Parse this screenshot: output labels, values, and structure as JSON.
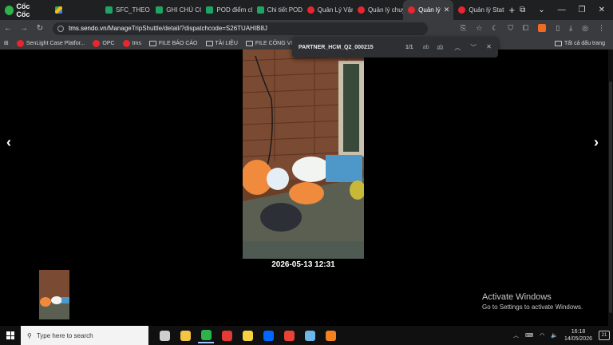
{
  "browser": {
    "brand": "Cốc Cốc",
    "tabs": [
      {
        "title": "",
        "favicon": "drive-icon"
      },
      {
        "title": "SFC_THEO D",
        "favicon": "sheets-icon"
      },
      {
        "title": "GHI CHÚ CÔ",
        "favicon": "sheets-icon"
      },
      {
        "title": "POD điểm cl",
        "favicon": "spreadsheet-icon"
      },
      {
        "title": "Chi tiết POD",
        "favicon": "spreadsheet-icon"
      },
      {
        "title": "Quản Lý Vận",
        "favicon": "sendo-icon"
      },
      {
        "title": "Quản lý chuy",
        "favicon": "sendo-icon"
      },
      {
        "title": "Quản lý",
        "favicon": "sendo-icon",
        "active": true
      },
      {
        "title": "Quản lý Stati",
        "favicon": "sendo-icon"
      }
    ],
    "url_host": "tms.sendo.vn",
    "url_path": "/ManageTripShuttle/detail/?dispatchcode=S26TUAHIB8J",
    "bookmarks": [
      {
        "label": "SenLight Case Platfor...",
        "type": "site"
      },
      {
        "label": "OPC",
        "type": "site"
      },
      {
        "label": "tms",
        "type": "site"
      },
      {
        "label": "FILE BÁO CÁO",
        "type": "folder"
      },
      {
        "label": "TÀI LIỆU",
        "type": "folder"
      },
      {
        "label": "FILE CÔNG VIỆC",
        "type": "folder"
      }
    ],
    "all_bookmarks": "Tất cả dấu trang"
  },
  "find_bar": {
    "query": "PARTNER_HCM_Q2_000215",
    "count": "1/1"
  },
  "viewer": {
    "photo_timestamp": "2026-05-13 12:31",
    "prev_symbol": "‹",
    "next_symbol": "›"
  },
  "watermark": {
    "title": "Activate Windows",
    "subtitle": "Go to Settings to activate Windows."
  },
  "taskbar": {
    "search_placeholder": "Type here to search",
    "time": "16:18",
    "date": "14/05/2026",
    "notification_count": "21",
    "apps": [
      {
        "name": "task-view-icon",
        "color": "#cfcfcf"
      },
      {
        "name": "file-explorer-icon",
        "color": "#f4c542"
      },
      {
        "name": "coccoc-browser-icon",
        "color": "#2db34a"
      },
      {
        "name": "wps-office-icon",
        "color": "#e53935"
      },
      {
        "name": "sticky-notes-icon",
        "color": "#f9d33f"
      },
      {
        "name": "zalo-icon",
        "color": "#0068ff"
      },
      {
        "name": "chrome-icon",
        "color": "#ea4335"
      },
      {
        "name": "app-icon",
        "color": "#6ab7e8"
      },
      {
        "name": "app-orange-icon",
        "color": "#f58220"
      }
    ]
  }
}
